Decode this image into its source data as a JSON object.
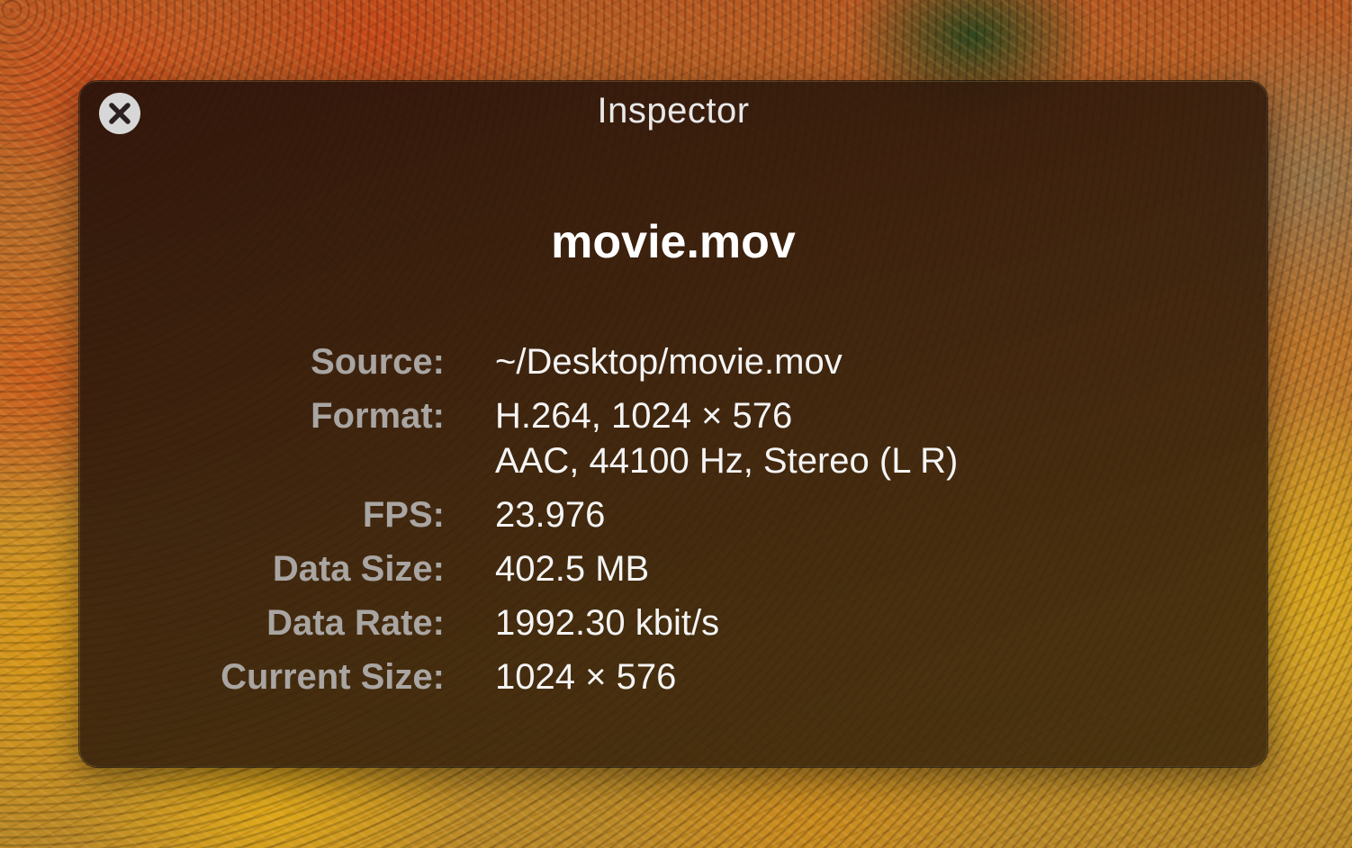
{
  "window": {
    "title": "Inspector",
    "close_icon": "close-x-circle-icon"
  },
  "file": {
    "name": "movie.mov"
  },
  "info": {
    "source_label": "Source:",
    "source_value": "~/Desktop/movie.mov",
    "format_label": "Format:",
    "format_video": "H.264, 1024 × 576",
    "format_audio": "AAC, 44100 Hz, Stereo (L R)",
    "fps_label": "FPS:",
    "fps_value": "23.976",
    "data_size_label": "Data Size:",
    "data_size_value": "402.5 MB",
    "data_rate_label": "Data Rate:",
    "data_rate_value": "1992.30 kbit/s",
    "current_size_label": "Current Size:",
    "current_size_value": "1024 × 576"
  },
  "colors": {
    "panel_background": "#2c170b",
    "label_text": "#a9a5a2",
    "value_text": "#f4f4f4",
    "close_button": "#d7d7d7"
  }
}
